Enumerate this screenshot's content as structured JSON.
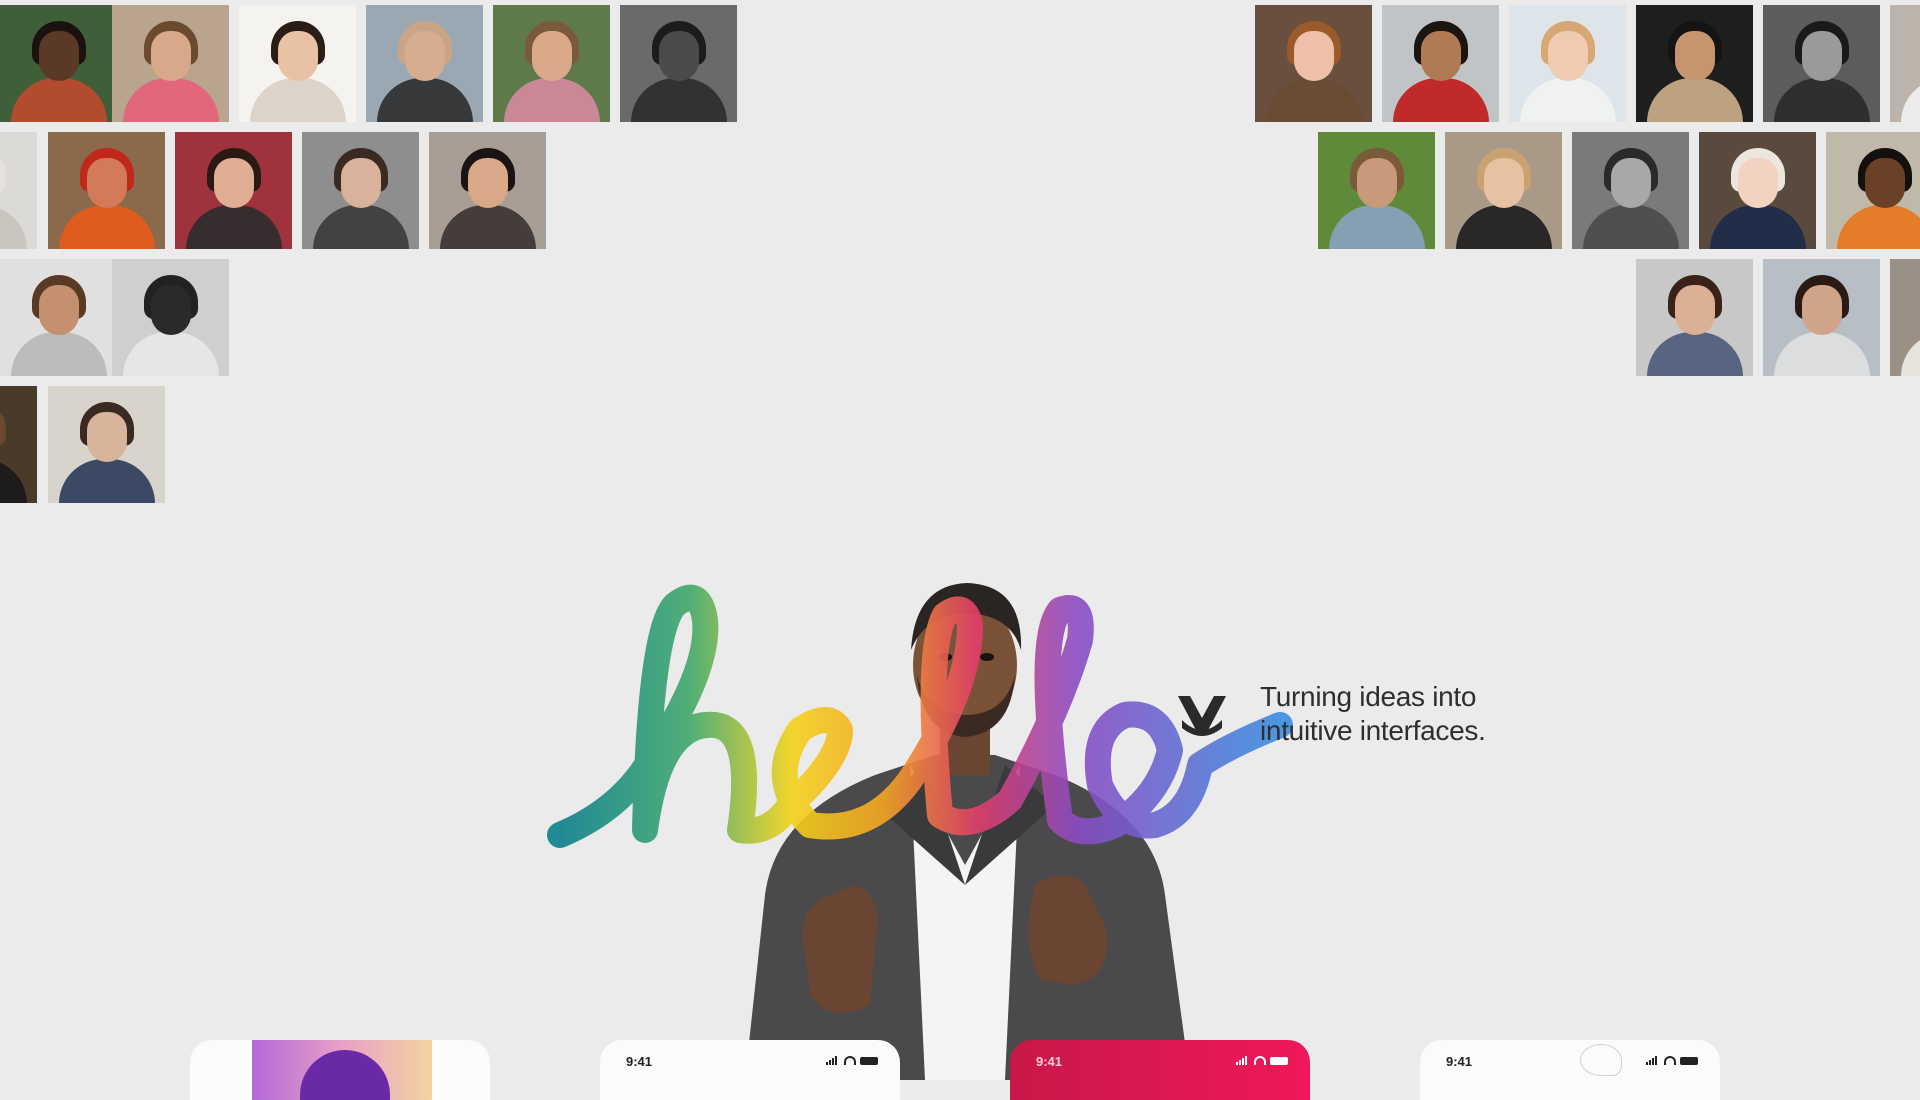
{
  "hero": {
    "greeting": "hello",
    "tagline_line1": "Turning ideas into",
    "tagline_line2": "intuitive interfaces."
  },
  "brand": {
    "logo": "v-shield-logo-icon"
  },
  "phones": [
    {
      "time": "",
      "variant": "image"
    },
    {
      "time": "9:41",
      "variant": "light"
    },
    {
      "time": "9:41",
      "variant": "pink"
    },
    {
      "time": "9:41",
      "variant": "light"
    }
  ],
  "colors": {
    "background": "#ebebeb",
    "text": "#2e2e2e",
    "accent_pink": "#e8185a",
    "hello_gradient": [
      "#0a7f8c",
      "#f2d21a",
      "#f5a623",
      "#e23d6a",
      "#8a4cc4",
      "#3b8de0"
    ]
  },
  "gallery": [
    {
      "skin": "#5a3a26",
      "hair": "#1b1210",
      "shirt": "#c04a2e",
      "bg": "#3f5e3a"
    },
    {
      "skin": "#d8a88a",
      "hair": "#6b4a2f",
      "shirt": "#e8607a",
      "bg": "#b9a48e"
    },
    {
      "skin": "#e9c2a3",
      "hair": "#2a1d15",
      "shirt": "#d9cfc6",
      "bg": "#f5f3f0"
    },
    {
      "skin": "#d6ad8e",
      "hair": "#c9a585",
      "shirt": "#2b2b2b",
      "bg": "#9aa8b3"
    },
    {
      "skin": "#d9a98a",
      "hair": "#7a5a3c",
      "shirt": "#d68aa0",
      "bg": "#5f7a4a"
    },
    {
      "skin": "#4a4a4a",
      "hair": "#1c1c1c",
      "shirt": "#2c2c2c",
      "bg": "#6a6a6a"
    },
    {
      "skin": "#eec0a8",
      "hair": "#9a5a2a",
      "shirt": "#6a4a32",
      "bg": "#6a4f3f"
    },
    {
      "skin": "#b07a55",
      "hair": "#1c1410",
      "shirt": "#c01a1a",
      "bg": "#c0c4c6"
    },
    {
      "skin": "#f0cbb0",
      "hair": "#d8a874",
      "shirt": "#f2f2f2",
      "bg": "#dde4ea"
    },
    {
      "skin": "#c79470",
      "hair": "#141414",
      "shirt": "#cdb08a",
      "bg": "#1e1e1e"
    },
    {
      "skin": "#9a9a9a",
      "hair": "#1a1a1a",
      "shirt": "#2a2a2a",
      "bg": "#5c5c5c"
    },
    {
      "skin": "#e8c9b3",
      "hair": "#e5e0da",
      "shirt": "#c7c2bd",
      "bg": "#dcdad7"
    },
    {
      "skin": "#d27a5a",
      "hair": "#c0281a",
      "shirt": "#e85a1a",
      "bg": "#8a6a4a"
    },
    {
      "skin": "#e0ae92",
      "hair": "#2a1a14",
      "shirt": "#2c2c2c",
      "bg": "#a0323e"
    },
    {
      "skin": "#d8b29a",
      "hair": "#3a2a22",
      "shirt": "#3a3a3a",
      "bg": "#8e8e8e"
    },
    {
      "skin": "#d9a888",
      "hair": "#1a1414",
      "shirt": "#3a3230",
      "bg": "#a89e96"
    },
    {
      "skin": "#c89a7a",
      "hair": "#7a5a38",
      "shirt": "#8aa2c0",
      "bg": "#5f8a3a"
    },
    {
      "skin": "#e6c2a2",
      "hair": "#caa272",
      "shirt": "#1c1c1c",
      "bg": "#a89a86"
    },
    {
      "skin": "#a8a8a8",
      "hair": "#2a2a2a",
      "shirt": "#4a4a4a",
      "bg": "#7a7a7a"
    },
    {
      "skin": "#f2d2c0",
      "hair": "#ece6de",
      "shirt": "#1c2a4a",
      "bg": "#5a4a3e"
    },
    {
      "skin": "#6a4026",
      "hair": "#141010",
      "shirt": "#e8761a",
      "bg": "#c0b8a8"
    },
    {
      "skin": "#c49070",
      "hair": "#5a3a22",
      "shirt": "#b8b8b8",
      "bg": "#e0e0e0"
    },
    {
      "skin": "#2a2a2a",
      "hair": "#222",
      "shirt": "#e8e8e8",
      "bg": "#cfcfcf"
    },
    {
      "skin": "#dcb094",
      "hair": "#3a2218",
      "shirt": "#4a5a7a",
      "bg": "#c8c8c8"
    },
    {
      "skin": "#d0a488",
      "hair": "#2a1a14",
      "shirt": "#e0e0e0",
      "bg": "#b8bec6"
    },
    {
      "skin": "#e6c0a6",
      "hair": "#1a1414",
      "shirt": "#f0ede8",
      "bg": "#9a9086"
    },
    {
      "skin": "#b8926e",
      "hair": "#6a4a2e",
      "shirt": "#1a1a1a",
      "bg": "#4a3a2a"
    },
    {
      "skin": "#d8b49a",
      "hair": "#3a2a22",
      "shirt": "#2a3a5a",
      "bg": "#d8d4cc"
    },
    {
      "skin": "#ecc8ae",
      "hair": "#1a1a1a",
      "shirt": "#f2f2f2",
      "bg": "#bcb4aa"
    }
  ]
}
